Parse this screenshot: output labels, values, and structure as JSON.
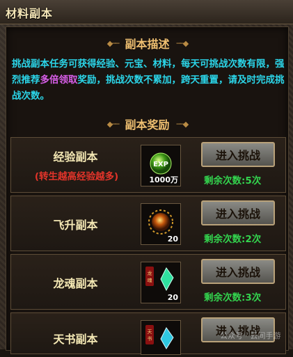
{
  "window": {
    "title": "材料副本"
  },
  "description": {
    "heading": "副本描述",
    "text_before": "挑战副本任务可获得经验、元宝、材料，每天可挑战次数有限，强烈推荐",
    "highlight": "多倍领取",
    "text_after": "奖励，挑战次数不累加，跨天重置，请及时完成挑战次数。"
  },
  "rewards": {
    "heading": "副本奖励",
    "rows": [
      {
        "name": "经验副本",
        "note": "(转生越高经验越多)",
        "item_icon": "exp-orb-icon",
        "item_label": "EXP",
        "qty": "1000万",
        "button": "进入挑战",
        "remaining": "剩余次数:5次"
      },
      {
        "name": "飞升副本",
        "note": "",
        "item_icon": "golden-orb-icon",
        "qty": "20",
        "button": "进入挑战",
        "remaining": "剩余次数:2次"
      },
      {
        "name": "龙魂副本",
        "note": "",
        "item_icon": "jade-crystal-icon",
        "item_label": "龙魂",
        "qty": "20",
        "button": "进入挑战",
        "remaining": "剩余次数:3次"
      },
      {
        "name": "天书副本",
        "note": "",
        "item_icon": "book-crystal-icon",
        "item_label": "天书",
        "qty": "",
        "button": "进入挑战",
        "remaining": ""
      }
    ]
  },
  "watermark": "公众号 · 云间手游",
  "colors": {
    "description": "#2bd5e8",
    "highlight": "#d85ee8",
    "remaining": "#33d44e",
    "note": "#e3342a",
    "heading": "#f0c071"
  }
}
